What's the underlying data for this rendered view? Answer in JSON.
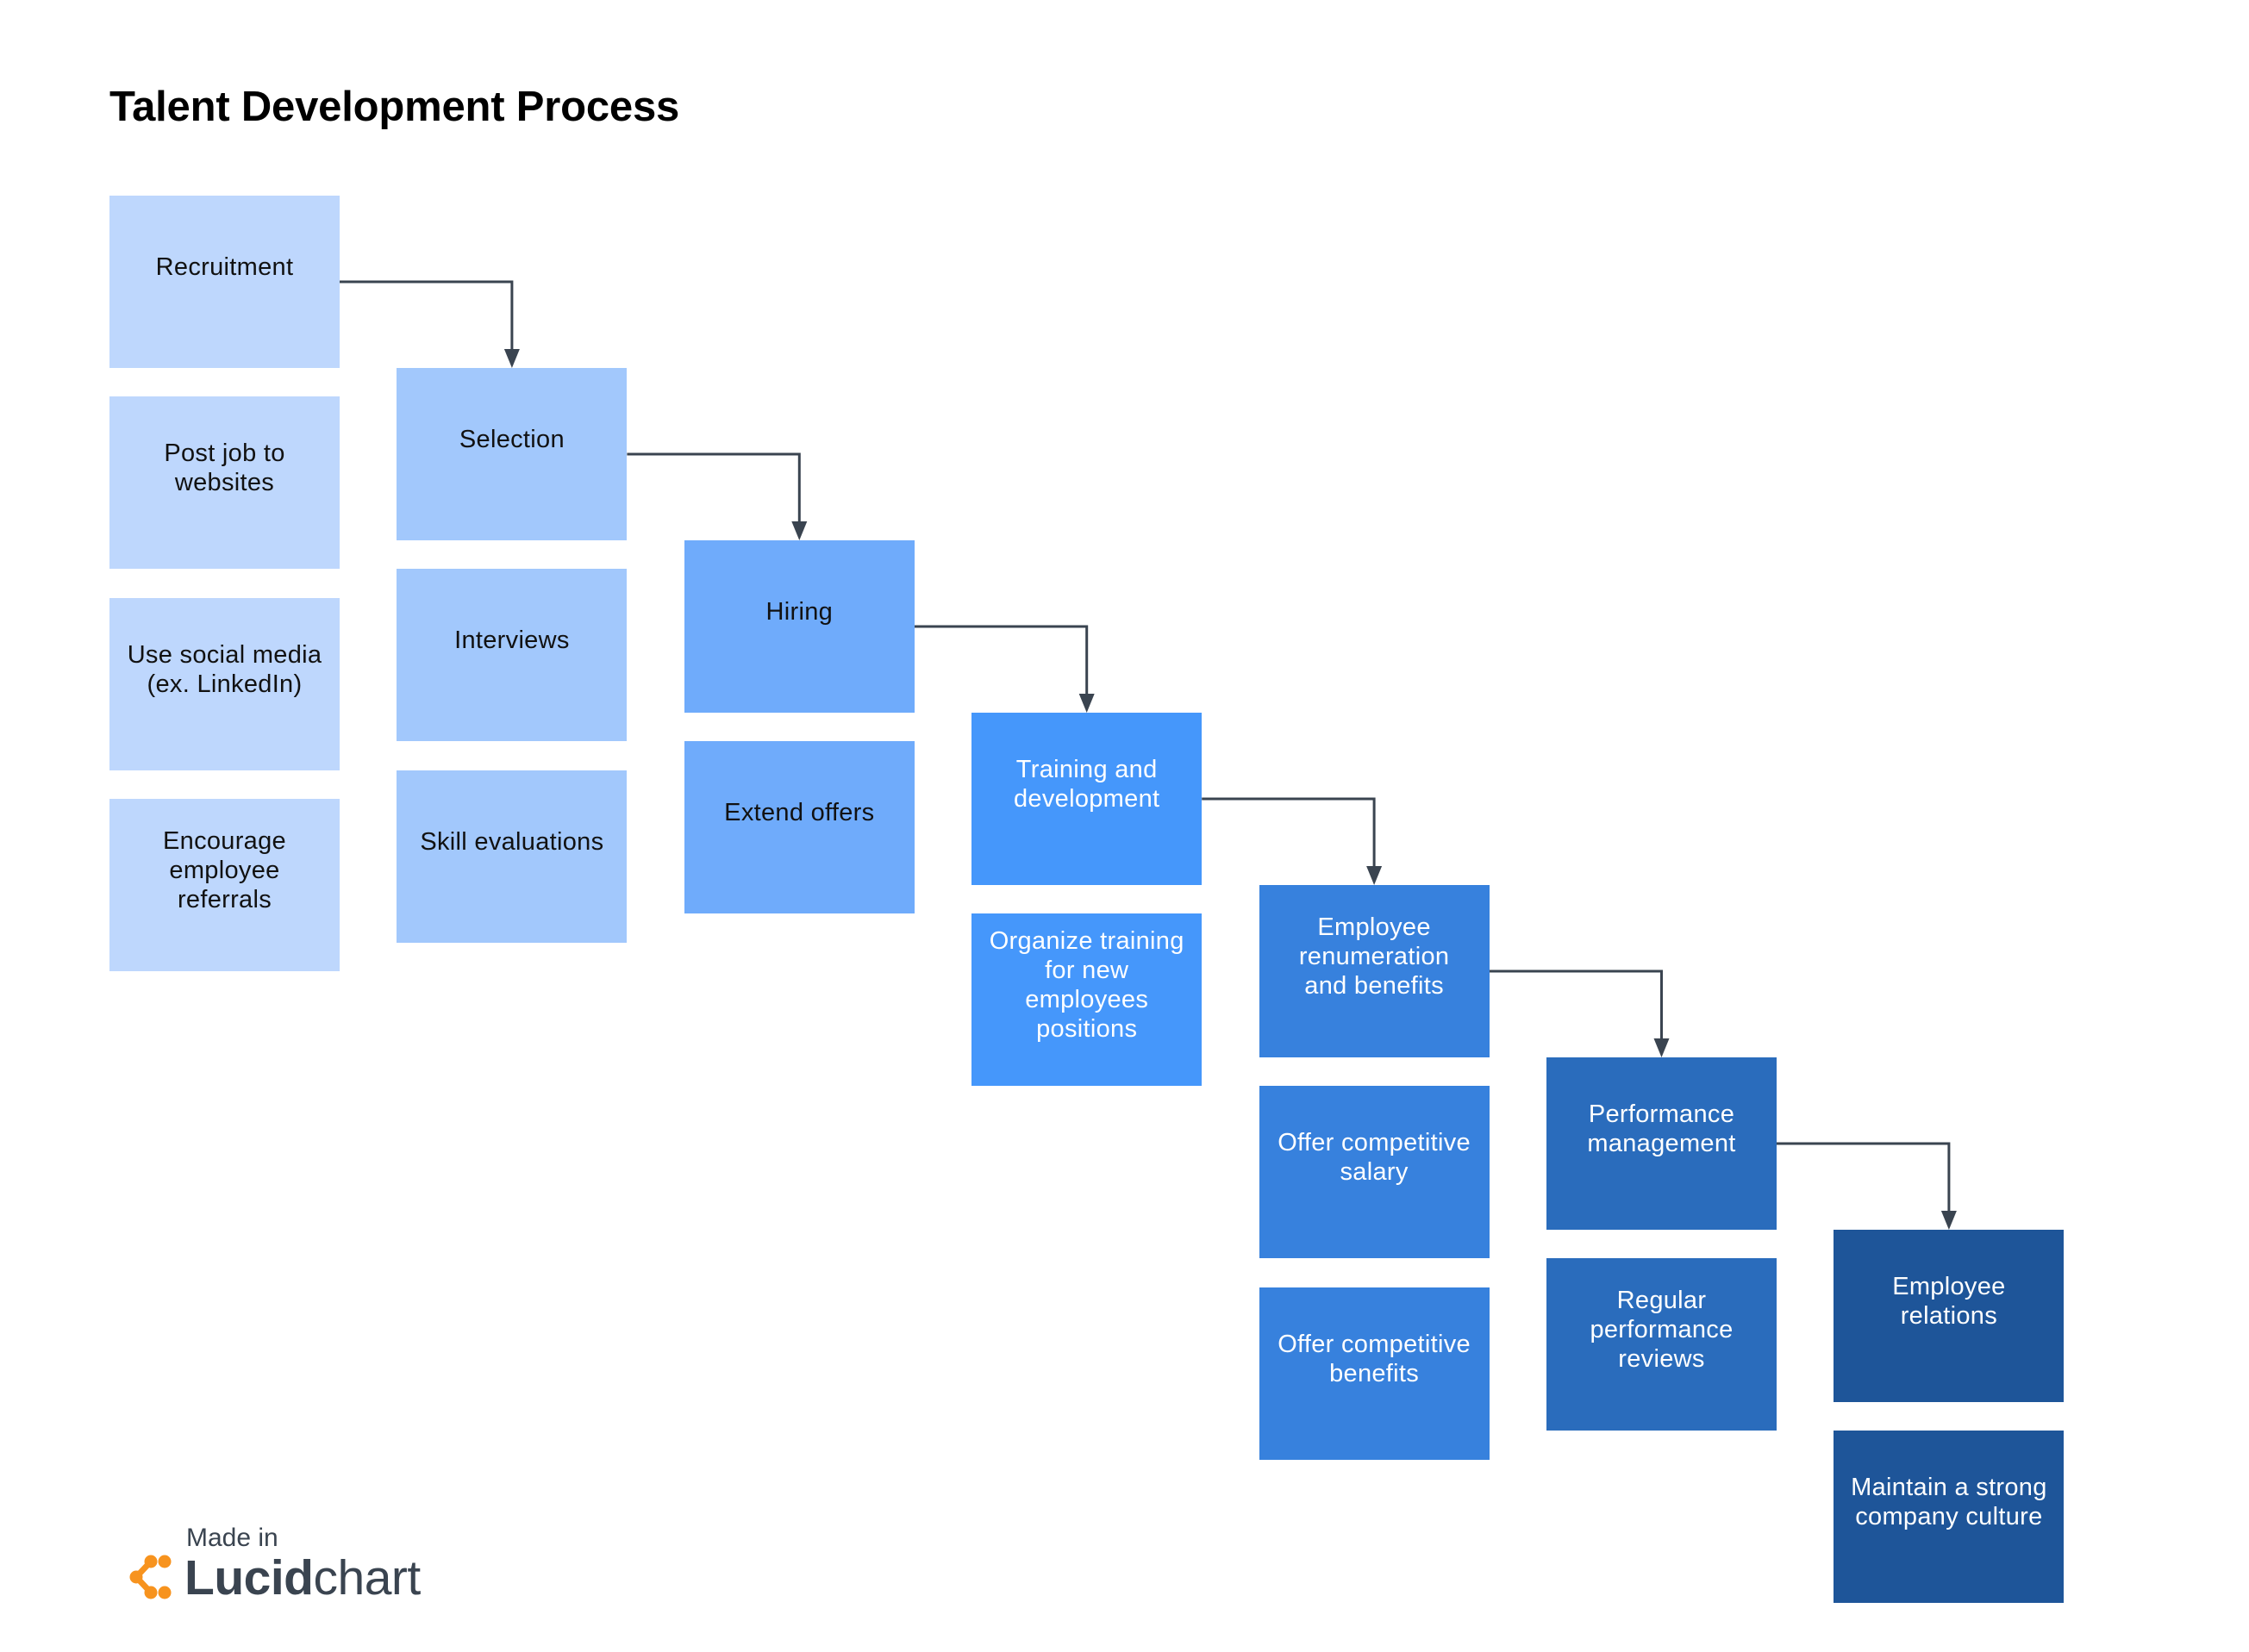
{
  "title": "Talent Development Process",
  "colors": {
    "connector": "#3a4450",
    "dark_text": "#111111",
    "light_text": "#ffffff",
    "logo_orange": "#f7931e",
    "logo_text": "#3a4450"
  },
  "stages": [
    {
      "label": "Recruitment",
      "color": "#bed7fd",
      "text_color": "#111111",
      "items": [
        "Post job to\nwebsites",
        "Use social media\n(ex. LinkedIn)",
        "Encourage\nemployee\nreferrals"
      ]
    },
    {
      "label": "Selection",
      "color": "#a2c8fc",
      "text_color": "#111111",
      "items": [
        "Interviews",
        "Skill evaluations"
      ]
    },
    {
      "label": "Hiring",
      "color": "#6fabfb",
      "text_color": "#111111",
      "items": [
        "Extend offers"
      ]
    },
    {
      "label": "Training and\ndevelopment",
      "color": "#4597fb",
      "text_color": "#ffffff",
      "items": [
        "Organize training\nfor new\nemployees\npositions"
      ]
    },
    {
      "label": "Employee\nrenumeration\nand benefits",
      "color": "#3781dd",
      "text_color": "#ffffff",
      "items": [
        "Offer competitive\nsalary",
        "Offer competitive\nbenefits"
      ]
    },
    {
      "label": "Performance\nmanagement",
      "color": "#2a6cbc",
      "text_color": "#ffffff",
      "items": [
        "Regular\nperformance\nreviews"
      ]
    },
    {
      "label": "Employee\nrelations",
      "color": "#1e5599",
      "text_color": "#ffffff",
      "items": [
        "Maintain a strong\ncompany culture"
      ]
    }
  ],
  "branding": {
    "made_in": "Made in",
    "brand_bold": "Lucid",
    "brand_light": "chart",
    "logo_icon": "lucid-dots-icon"
  }
}
